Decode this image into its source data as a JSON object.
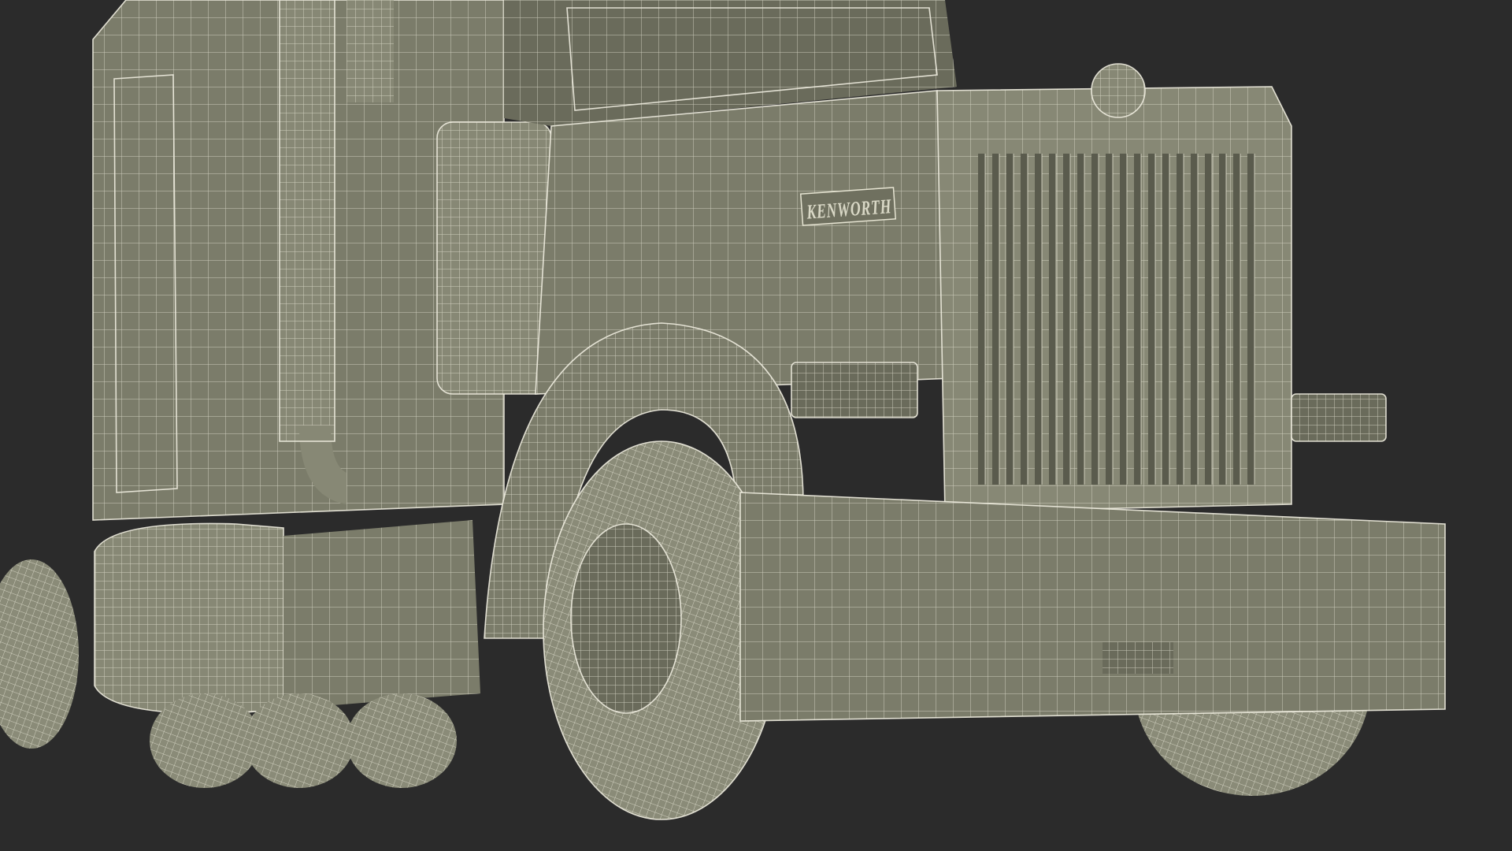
{
  "scene": {
    "subject": "wireframe-truck-render",
    "colors": {
      "background": "#2b2b2b",
      "body": "#7b7c6a",
      "wireframe": "#e8e6d6"
    }
  },
  "badge": {
    "text": "KENWORTH"
  }
}
